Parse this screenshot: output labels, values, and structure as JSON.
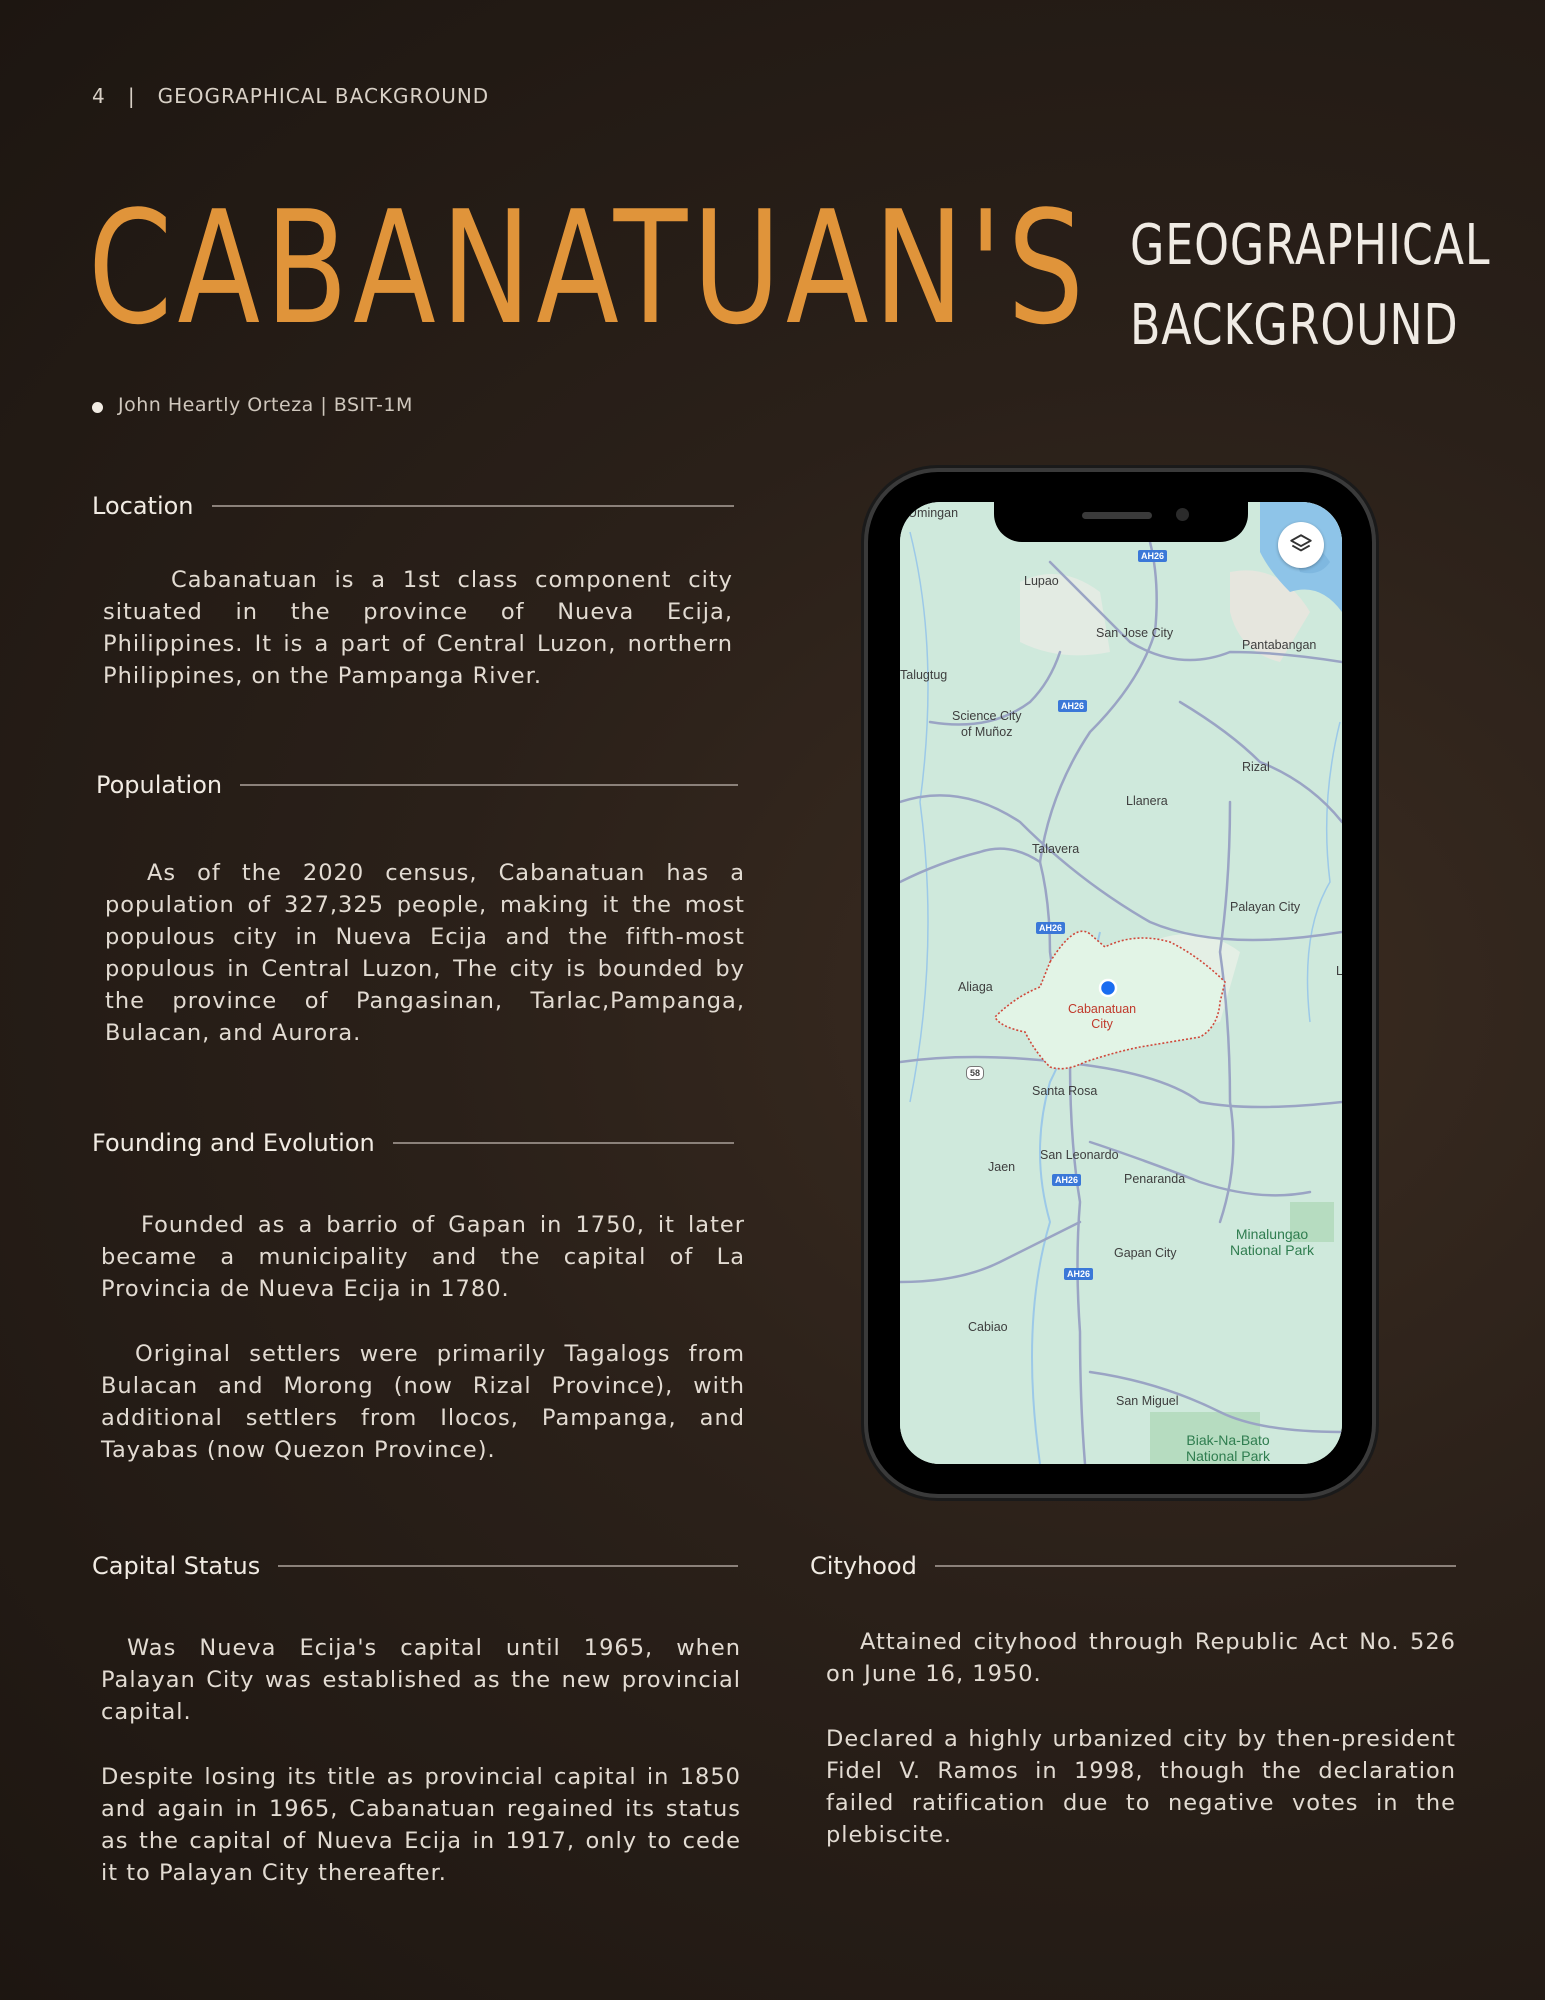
{
  "header": {
    "page_number": "4",
    "separator": "|",
    "section": "GEOGRAPHICAL BACKGROUND"
  },
  "title": {
    "main": "CABANATUAN'S",
    "sub_line1": "GEOGRAPHICAL",
    "sub_line2": "BACKGROUND"
  },
  "author": "John Heartly Orteza | BSIT-1M",
  "sections": {
    "location": {
      "heading": "Location",
      "paragraphs": [
        "Cabanatuan is a 1st class component city situated in the province of Nueva Ecija, Philippines. It is a part of Central Luzon, northern Philippines, on the Pampanga River."
      ]
    },
    "population": {
      "heading": "Population",
      "paragraphs": [
        "As of the 2020 census, Cabanatuan has a population of 327,325 people, making it the most populous city in Nueva Ecija and the fifth-most populous in Central Luzon, The city is bounded by the province of Pangasinan, Tarlac,Pampanga, Bulacan, and Aurora."
      ]
    },
    "founding": {
      "heading": "Founding and Evolution",
      "paragraphs": [
        "Founded as a barrio of Gapan in 1750, it later became a municipality and the capital of La Provincia de Nueva Ecija in 1780.",
        "Original settlers were primarily Tagalogs from Bulacan and Morong (now Rizal Province), with additional settlers from Ilocos, Pampanga, and Tayabas (now Quezon Province)."
      ]
    },
    "capital": {
      "heading": "Capital Status",
      "paragraphs": [
        "Was Nueva Ecija's capital until 1965, when Palayan City was established as the new provincial capital.",
        "Despite losing its title as provincial capital in 1850 and again in 1965, Cabanatuan regained its status as the capital of Nueva Ecija in 1917, only to cede it to Palayan City thereafter."
      ]
    },
    "cityhood": {
      "heading": "Cityhood",
      "paragraphs": [
        "Attained cityhood through Republic Act No. 526 on June 16, 1950.",
        "Declared a highly urbanized city by then-president Fidel V. Ramos in 1998, though the declaration failed ratification due to negative votes in the plebiscite."
      ]
    }
  },
  "map": {
    "places": {
      "umingan": "Umingan",
      "lupao": "Lupao",
      "san_jose": "San Jose City",
      "pantabangan": "Pantabangan",
      "talugtug": "Talugtug",
      "munoz1": "Science City",
      "munoz2": "of Muñoz",
      "rizal": "Rizal",
      "llanera": "Llanera",
      "talavera": "Talavera",
      "palayan": "Palayan City",
      "aliaga": "Aliaga",
      "cab1": "Cabanatuan",
      "cab2": "City",
      "santa_rosa": "Santa Rosa",
      "san_leonardo": "San Leonardo",
      "jaen": "Jaen",
      "penaranda": "Penaranda",
      "gapan": "Gapan City",
      "park1a": "Minalungao",
      "park1b": "National Park",
      "cabiao": "Cabiao",
      "san_miguel": "San Miguel",
      "park2a": "Biak-Na-Bato",
      "park2b": "National Park",
      "edge_l": "L"
    },
    "shields": {
      "ah26": "AH26",
      "r58": "58"
    },
    "colors": {
      "land": "#cfe9dc",
      "road": "#9aa4c4",
      "water": "#8ec4e8",
      "boundary": "#d0483a",
      "marker": "#1a6cf0"
    }
  }
}
